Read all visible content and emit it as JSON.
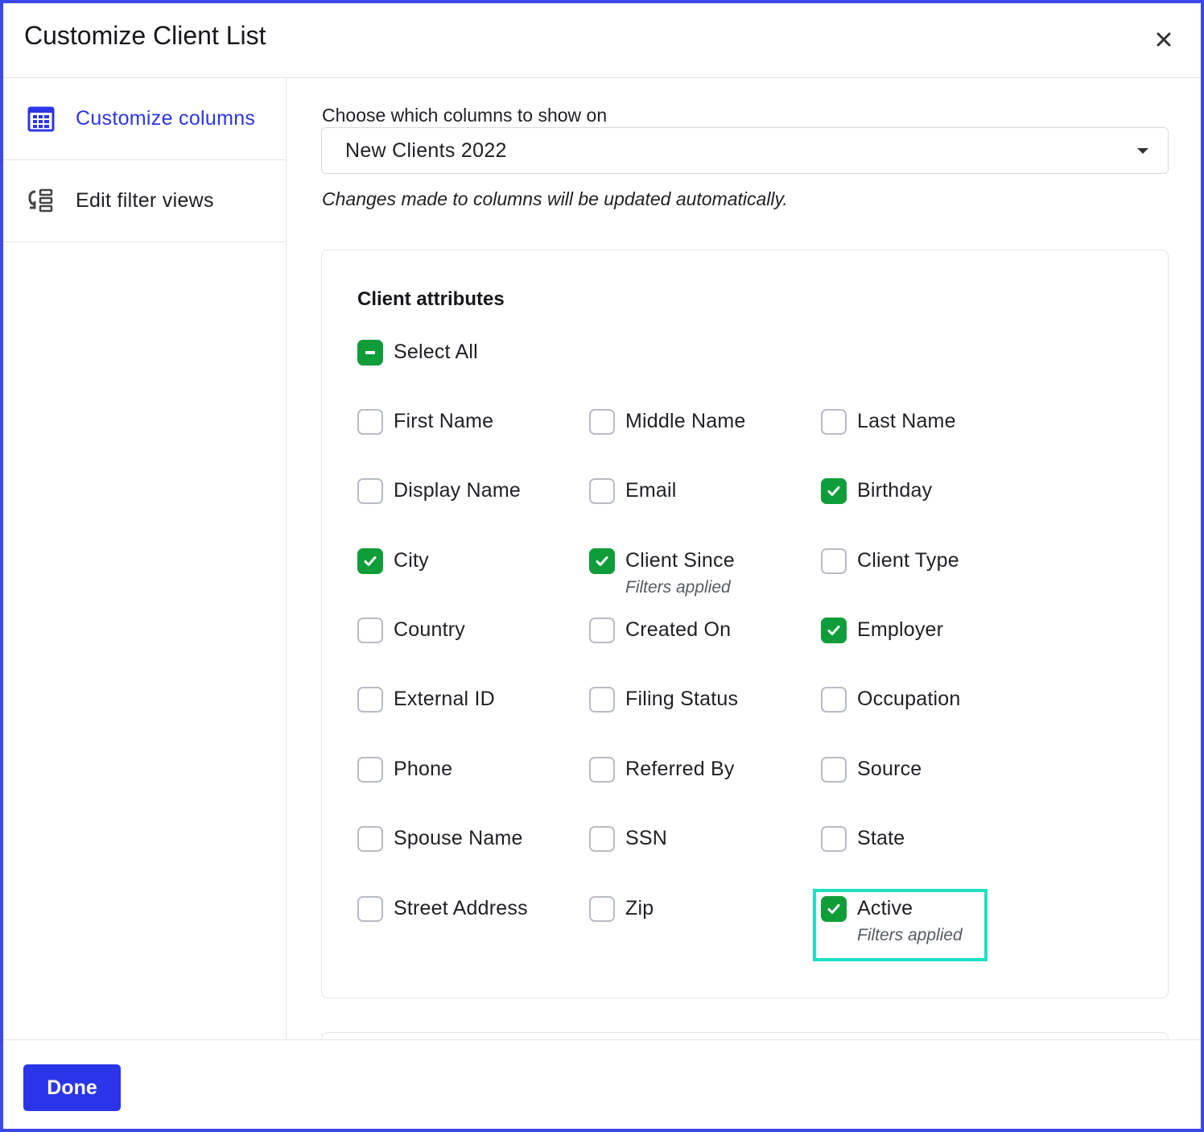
{
  "modal": {
    "title": "Customize Client List",
    "close_icon": "close-icon"
  },
  "sidebar": {
    "items": [
      {
        "label": "Customize columns",
        "icon": "table-grid-icon",
        "active": true
      },
      {
        "label": "Edit filter views",
        "icon": "filter-list-icon",
        "active": false
      }
    ]
  },
  "main": {
    "select_label": "Choose which columns to show on",
    "select_value": "New Clients 2022",
    "note": "Changes made to columns will be updated automatically."
  },
  "attributes": {
    "title": "Client attributes",
    "select_all": {
      "label": "Select All",
      "state": "partial"
    },
    "options": [
      {
        "label": "First Name",
        "checked": false
      },
      {
        "label": "Middle Name",
        "checked": false
      },
      {
        "label": "Last Name",
        "checked": false
      },
      {
        "label": "Display Name",
        "checked": false
      },
      {
        "label": "Email",
        "checked": false
      },
      {
        "label": "Birthday",
        "checked": true
      },
      {
        "label": "City",
        "checked": true
      },
      {
        "label": "Client Since",
        "checked": true,
        "sub": "Filters applied"
      },
      {
        "label": "Client Type",
        "checked": false
      },
      {
        "label": "Country",
        "checked": false
      },
      {
        "label": "Created On",
        "checked": false
      },
      {
        "label": "Employer",
        "checked": true
      },
      {
        "label": "External ID",
        "checked": false
      },
      {
        "label": "Filing Status",
        "checked": false
      },
      {
        "label": "Occupation",
        "checked": false
      },
      {
        "label": "Phone",
        "checked": false
      },
      {
        "label": "Referred By",
        "checked": false
      },
      {
        "label": "Source",
        "checked": false
      },
      {
        "label": "Spouse Name",
        "checked": false
      },
      {
        "label": "SSN",
        "checked": false
      },
      {
        "label": "State",
        "checked": false
      },
      {
        "label": "Street Address",
        "checked": false
      },
      {
        "label": "Zip",
        "checked": false
      },
      {
        "label": "Active",
        "checked": true,
        "sub": "Filters applied"
      }
    ]
  },
  "footer": {
    "done_label": "Done"
  },
  "colors": {
    "accent": "#2b35e8",
    "check": "#0f9d3a",
    "highlight": "#1fe0c2"
  }
}
